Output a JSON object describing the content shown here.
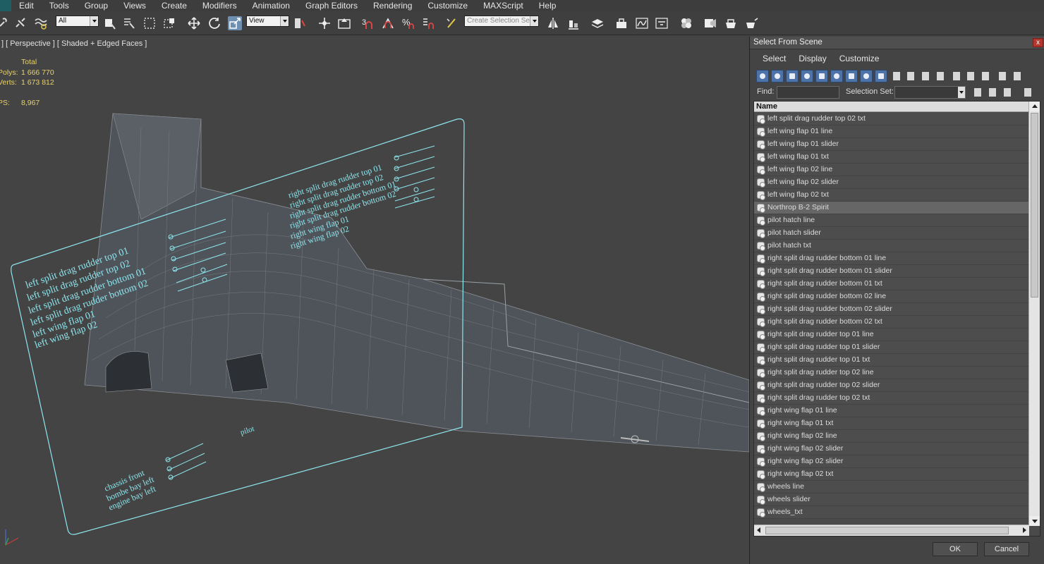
{
  "menu": [
    "Edit",
    "Tools",
    "Group",
    "Views",
    "Create",
    "Modifiers",
    "Animation",
    "Graph Editors",
    "Rendering",
    "Customize",
    "MAXScript",
    "Help"
  ],
  "toolbar": {
    "selection_filter": "All",
    "reference_coord": "View",
    "named_selection_placeholder": "Create Selection Se",
    "snap_label": "3"
  },
  "viewport": {
    "label": "] [ Perspective ] [ Shaded + Edged Faces ]",
    "stats": {
      "total_label": "Total",
      "polys_label": "Polys:",
      "polys_value": "1 666 770",
      "verts_label": "Verts:",
      "verts_value": "1 673 812",
      "fps_label": "PS:",
      "fps_value": "8,967"
    },
    "panel_texts": {
      "right_group": [
        "right split drag rudder top 01",
        "right split drag rudder top 02",
        "right split drag rudder bottom 01",
        "right split drag rudder bottom 02",
        "right wing flap 01",
        "right wing flap 02"
      ],
      "left_group": [
        "left split drag rudder top 01",
        "left split drag rudder top 02",
        "left split drag rudder bottom 01",
        "left split drag rudder bottom 02",
        "left wing flap 01",
        "left wing flap 02"
      ],
      "bottom_group": [
        "chassis front",
        "bombe bay left",
        "engine bay left"
      ],
      "pilot_label": "pilot"
    }
  },
  "dialog": {
    "title": "Select From Scene",
    "close": "x",
    "menu": [
      "Select",
      "Display",
      "Customize"
    ],
    "find_label": "Find:",
    "find_value": "",
    "selection_set_label": "Selection Set:",
    "column_header": "Name",
    "items": [
      "left split drag rudder top 02 txt",
      "left wing flap 01 line",
      "left wing flap 01 slider",
      "left wing flap 01 txt",
      "left wing flap 02 line",
      "left wing flap 02 slider",
      "left wing flap 02 txt",
      "Northrop B-2 Spirit",
      "pilot hatch line",
      "pilot hatch slider",
      "pilot hatch txt",
      "right split drag rudder bottom 01 line",
      "right split drag rudder bottom 01 slider",
      "right split drag rudder bottom 01 txt",
      "right split drag rudder bottom 02 line",
      "right split drag rudder bottom 02 slider",
      "right split drag rudder bottom 02 txt",
      "right split drag rudder top 01 line",
      "right split drag rudder top 01 slider",
      "right split drag rudder top 01 txt",
      "right split drag rudder top 02 line",
      "right split drag rudder top 02 slider",
      "right split drag rudder top 02 txt",
      "right wing flap 01 line",
      "right wing flap 01 txt",
      "right wing flap 02 line",
      "right wing flap 02 slider",
      "right wing flap 02 slider",
      "right wing flap 02 txt",
      "wheels line",
      "wheels slider",
      "wheels_txt"
    ],
    "selected_item": "Northrop B-2 Spirit",
    "ok_label": "OK",
    "cancel_label": "Cancel"
  },
  "colors": {
    "panel_text": "#8de6ee",
    "stats_text": "#e8d26a",
    "active_tool": "#6d8fb2",
    "dialog_icon": "#4e73a9"
  }
}
